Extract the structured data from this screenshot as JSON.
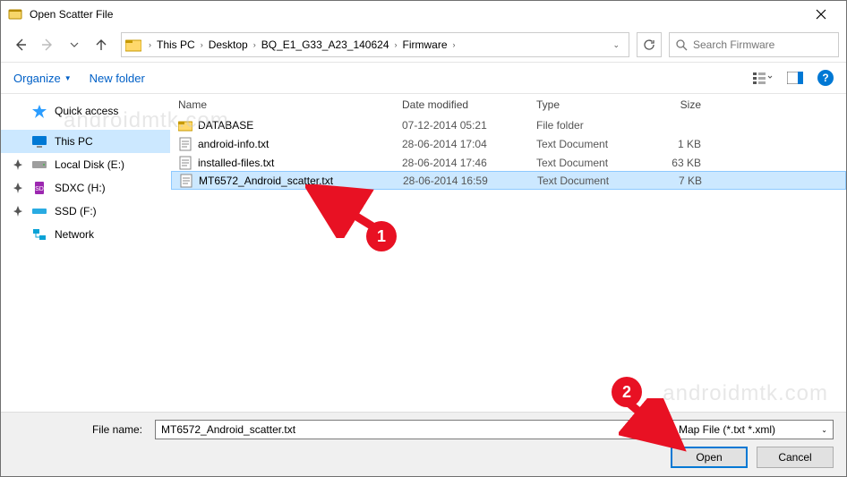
{
  "title": "Open Scatter File",
  "breadcrumb": [
    "This PC",
    "Desktop",
    "BQ_E1_G33_A23_140624",
    "Firmware"
  ],
  "search_placeholder": "Search Firmware",
  "toolbar": {
    "organize": "Organize",
    "newfolder": "New folder"
  },
  "sidebar": [
    {
      "label": "Quick access",
      "icon": "star",
      "color": "#2b9dff",
      "pin": false
    },
    {
      "label": "This PC",
      "icon": "monitor",
      "color": "#0078d4",
      "selected": true,
      "pin": false
    },
    {
      "label": "Local Disk (E:)",
      "icon": "disk",
      "color": "#9e9e9e",
      "pin": true
    },
    {
      "label": "SDXC (H:)",
      "icon": "sd",
      "color": "#9c27b0",
      "pin": true
    },
    {
      "label": "SSD (F:)",
      "icon": "ssd",
      "color": "#29abe2",
      "pin": true
    },
    {
      "label": "Network",
      "icon": "network",
      "color": "#0aa2d6",
      "pin": false
    }
  ],
  "columns": {
    "name": "Name",
    "date": "Date modified",
    "type": "Type",
    "size": "Size"
  },
  "files": [
    {
      "name": "DATABASE",
      "date": "07-12-2014 05:21",
      "type": "File folder",
      "size": "",
      "icon": "folder"
    },
    {
      "name": "android-info.txt",
      "date": "28-06-2014 17:04",
      "type": "Text Document",
      "size": "1 KB",
      "icon": "txt"
    },
    {
      "name": "installed-files.txt",
      "date": "28-06-2014 17:46",
      "type": "Text Document",
      "size": "63 KB",
      "icon": "txt"
    },
    {
      "name": "MT6572_Android_scatter.txt",
      "date": "28-06-2014 16:59",
      "type": "Text Document",
      "size": "7 KB",
      "icon": "txt",
      "selected": true
    }
  ],
  "bottom": {
    "filename_label": "File name:",
    "filename_value": "MT6572_Android_scatter.txt",
    "filetype": "Map File (*.txt *.xml)",
    "open": "Open",
    "cancel": "Cancel"
  },
  "markers": {
    "m1": "1",
    "m2": "2"
  },
  "watermark": "androidmtk.com"
}
